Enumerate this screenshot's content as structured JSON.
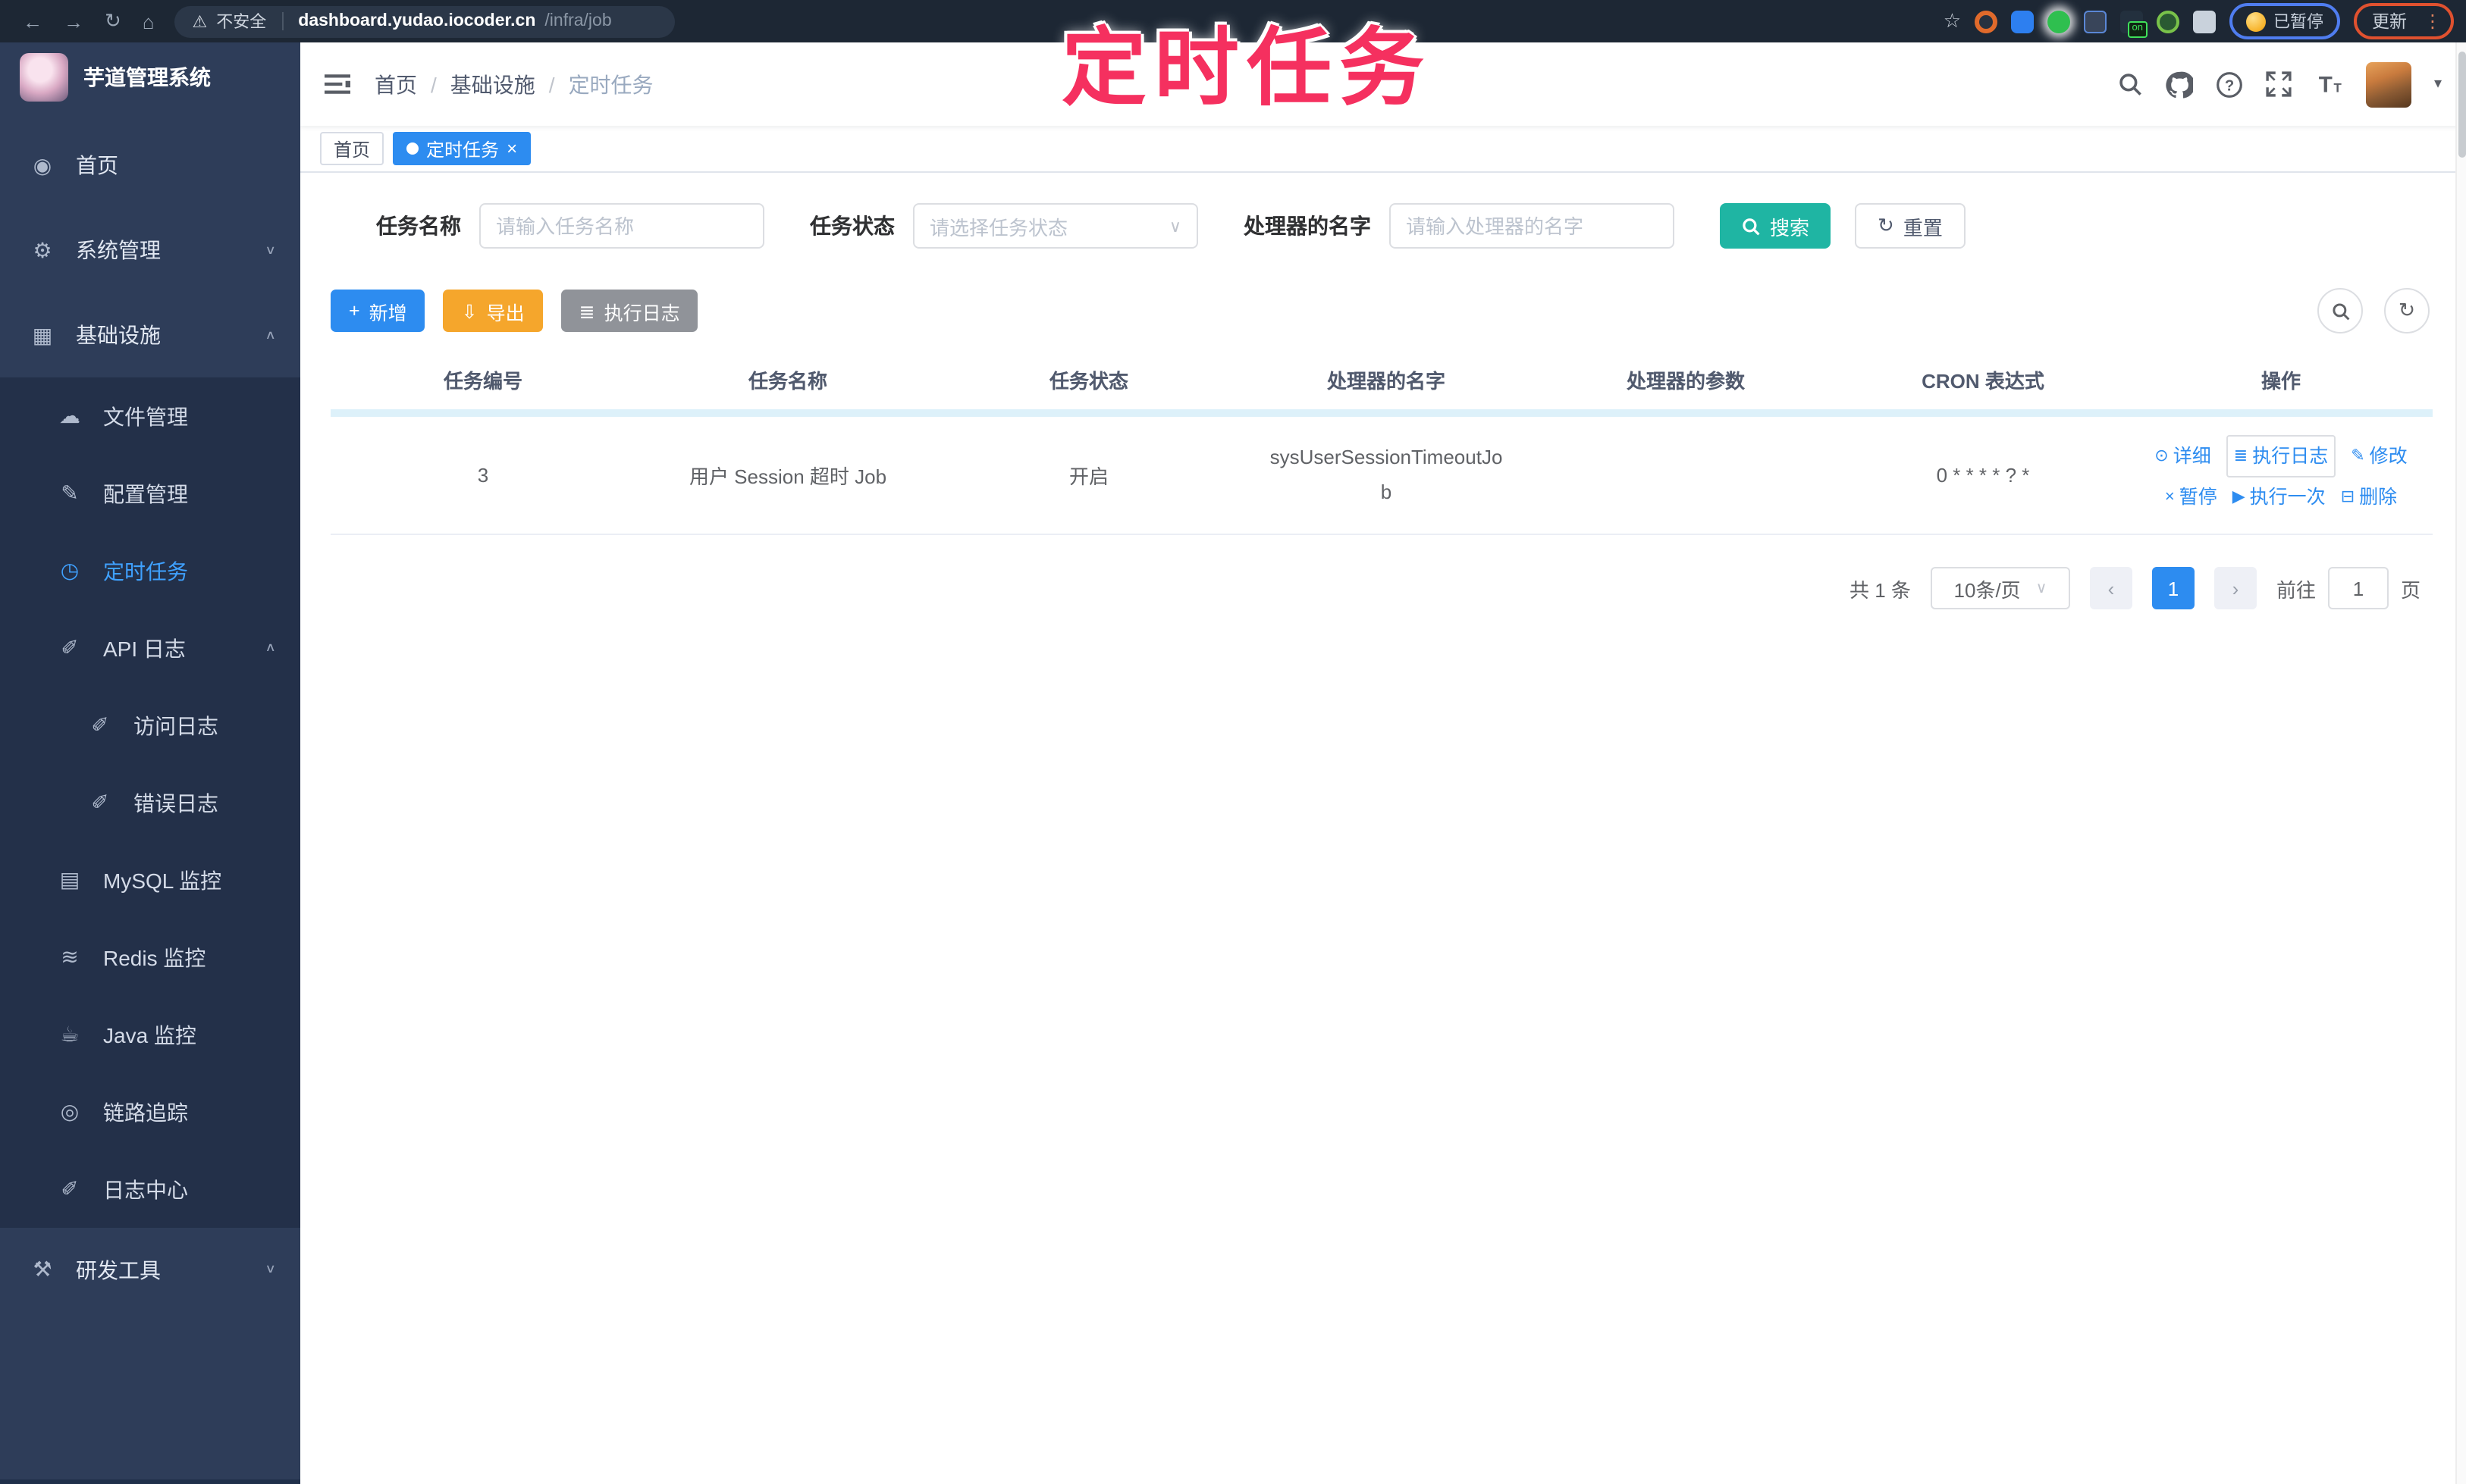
{
  "browser": {
    "security_label": "不安全",
    "host": "dashboard.yudao.iocoder.cn",
    "path": "/infra/job",
    "paused_badge": "已暂停",
    "update_button": "更新",
    "extension_on_badge": "on"
  },
  "annotation": {
    "title": "定时任务"
  },
  "sidebar": {
    "app_title": "芋道管理系统",
    "items": [
      {
        "label": "首页"
      },
      {
        "label": "系统管理"
      },
      {
        "label": "基础设施"
      },
      {
        "label": "文件管理"
      },
      {
        "label": "配置管理"
      },
      {
        "label": "定时任务"
      },
      {
        "label": "API 日志"
      },
      {
        "label": "访问日志"
      },
      {
        "label": "错误日志"
      },
      {
        "label": "MySQL 监控"
      },
      {
        "label": "Redis 监控"
      },
      {
        "label": "Java 监控"
      },
      {
        "label": "链路追踪"
      },
      {
        "label": "日志中心"
      },
      {
        "label": "研发工具"
      }
    ]
  },
  "breadcrumb": {
    "items": [
      "首页",
      "基础设施",
      "定时任务"
    ],
    "separator": "/"
  },
  "tags": {
    "home": "首页",
    "active": "定时任务"
  },
  "filters": {
    "name_label": "任务名称",
    "name_placeholder": "请输入任务名称",
    "status_label": "任务状态",
    "status_placeholder": "请选择任务状态",
    "handler_label": "处理器的名字",
    "handler_placeholder": "请输入处理器的名字",
    "search_button": "搜索",
    "reset_button": "重置"
  },
  "toolbar": {
    "add_button": "新增",
    "export_button": "导出",
    "exec_log_button": "执行日志"
  },
  "table": {
    "columns": [
      "任务编号",
      "任务名称",
      "任务状态",
      "处理器的名字",
      "处理器的参数",
      "CRON 表达式",
      "操作"
    ],
    "row": {
      "id": "3",
      "name": "用户 Session 超时 Job",
      "status": "开启",
      "handler": "sysUserSessionTimeoutJob",
      "params": "",
      "cron": "0 * * * * ? *"
    },
    "actions": {
      "detail": "详细",
      "exec_log": "执行日志",
      "edit": "修改",
      "pause": "暂停",
      "run_once": "执行一次",
      "delete": "删除"
    }
  },
  "pagination": {
    "total": "共 1 条",
    "page_size": "10条/页",
    "current_page": "1",
    "goto_label": "前往",
    "goto_value": "1",
    "page_unit": "页"
  },
  "colors": {
    "primary": "#2d8cf0",
    "search_teal": "#1fb5a3",
    "export_amber": "#f5a62c",
    "info_gray": "#909399",
    "sidebar_bg": "#2e3d59",
    "submenu_bg": "#233049",
    "active_text": "#3fa1ff",
    "annotation_pink": "#f5305f"
  },
  "icons": {
    "back": "←",
    "forward": "→",
    "reload": "↻",
    "home": "⌂",
    "warning": "⚠",
    "star": "☆",
    "dashboard": "◉",
    "gear": "⚙",
    "infra": "▦",
    "cloud_upload": "☁",
    "config_edit": "✎",
    "timer": "◷",
    "api_log": "✐",
    "access_log": "✐",
    "error_log": "✐",
    "mysql": "▤",
    "redis": "≋",
    "java": "☕",
    "trace": "◎",
    "log_center": "✐",
    "devtools": "⚒",
    "chevron_down": "∨",
    "chevron_up": "∧",
    "caret_down": "▾",
    "select_arrow": "∨",
    "plus": "+",
    "download": "⇩",
    "list": "≣",
    "refresh": "↻",
    "view": "⊙",
    "edit": "✎",
    "pause": "×",
    "play": "▶",
    "trash": "⊟",
    "prev": "‹",
    "next": "›",
    "dot": "●",
    "close": "×",
    "kebab": "⋮"
  }
}
